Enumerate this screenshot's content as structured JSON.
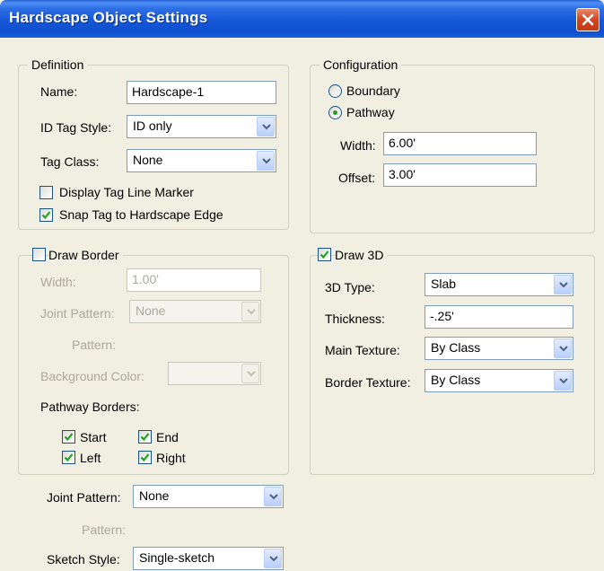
{
  "window": {
    "title": "Hardscape Object Settings",
    "close_icon": "close-icon"
  },
  "definition": {
    "legend": "Definition",
    "name_label": "Name:",
    "name_value": "Hardscape-1",
    "id_tag_style_label": "ID Tag Style:",
    "id_tag_style_value": "ID only",
    "tag_class_label": "Tag Class:",
    "tag_class_value": "None",
    "display_tag_line_marker": {
      "label": "Display Tag Line Marker",
      "checked": false
    },
    "snap_tag_to_edge": {
      "label": "Snap Tag to Hardscape Edge",
      "checked": true
    }
  },
  "configuration": {
    "legend": "Configuration",
    "boundary_label": "Boundary",
    "pathway_label": "Pathway",
    "selected": "Pathway",
    "width_label": "Width:",
    "width_value": "6.00'",
    "offset_label": "Offset:",
    "offset_value": "3.00'"
  },
  "draw_border": {
    "label": "Draw Border",
    "checked": false,
    "width_label": "Width:",
    "width_value": "1.00'",
    "joint_pattern_label": "Joint Pattern:",
    "joint_pattern_value": "None",
    "pattern_label": "Pattern:",
    "background_color_label": "Background Color:",
    "background_color_value": "",
    "pathway_borders_label": "Pathway Borders:",
    "start": {
      "label": "Start",
      "checked": true
    },
    "end": {
      "label": "End",
      "checked": true
    },
    "left": {
      "label": "Left",
      "checked": true
    },
    "right": {
      "label": "Right",
      "checked": true
    }
  },
  "draw_3d": {
    "label": "Draw 3D",
    "checked": true,
    "type_label": "3D Type:",
    "type_value": "Slab",
    "thickness_label": "Thickness:",
    "thickness_value": "-.25'",
    "main_texture_label": "Main Texture:",
    "main_texture_value": "By Class",
    "border_texture_label": "Border Texture:",
    "border_texture_value": "By Class"
  },
  "bottom": {
    "joint_pattern_label": "Joint Pattern:",
    "joint_pattern_value": "None",
    "pattern_label": "Pattern:",
    "sketch_style_label": "Sketch Style:",
    "sketch_style_value": "Single-sketch"
  },
  "colors": {
    "titlebar": "#0e4fd0",
    "dialog_bg": "#f1efe2",
    "check_green": "#21a121",
    "close_red": "#d0461f"
  }
}
